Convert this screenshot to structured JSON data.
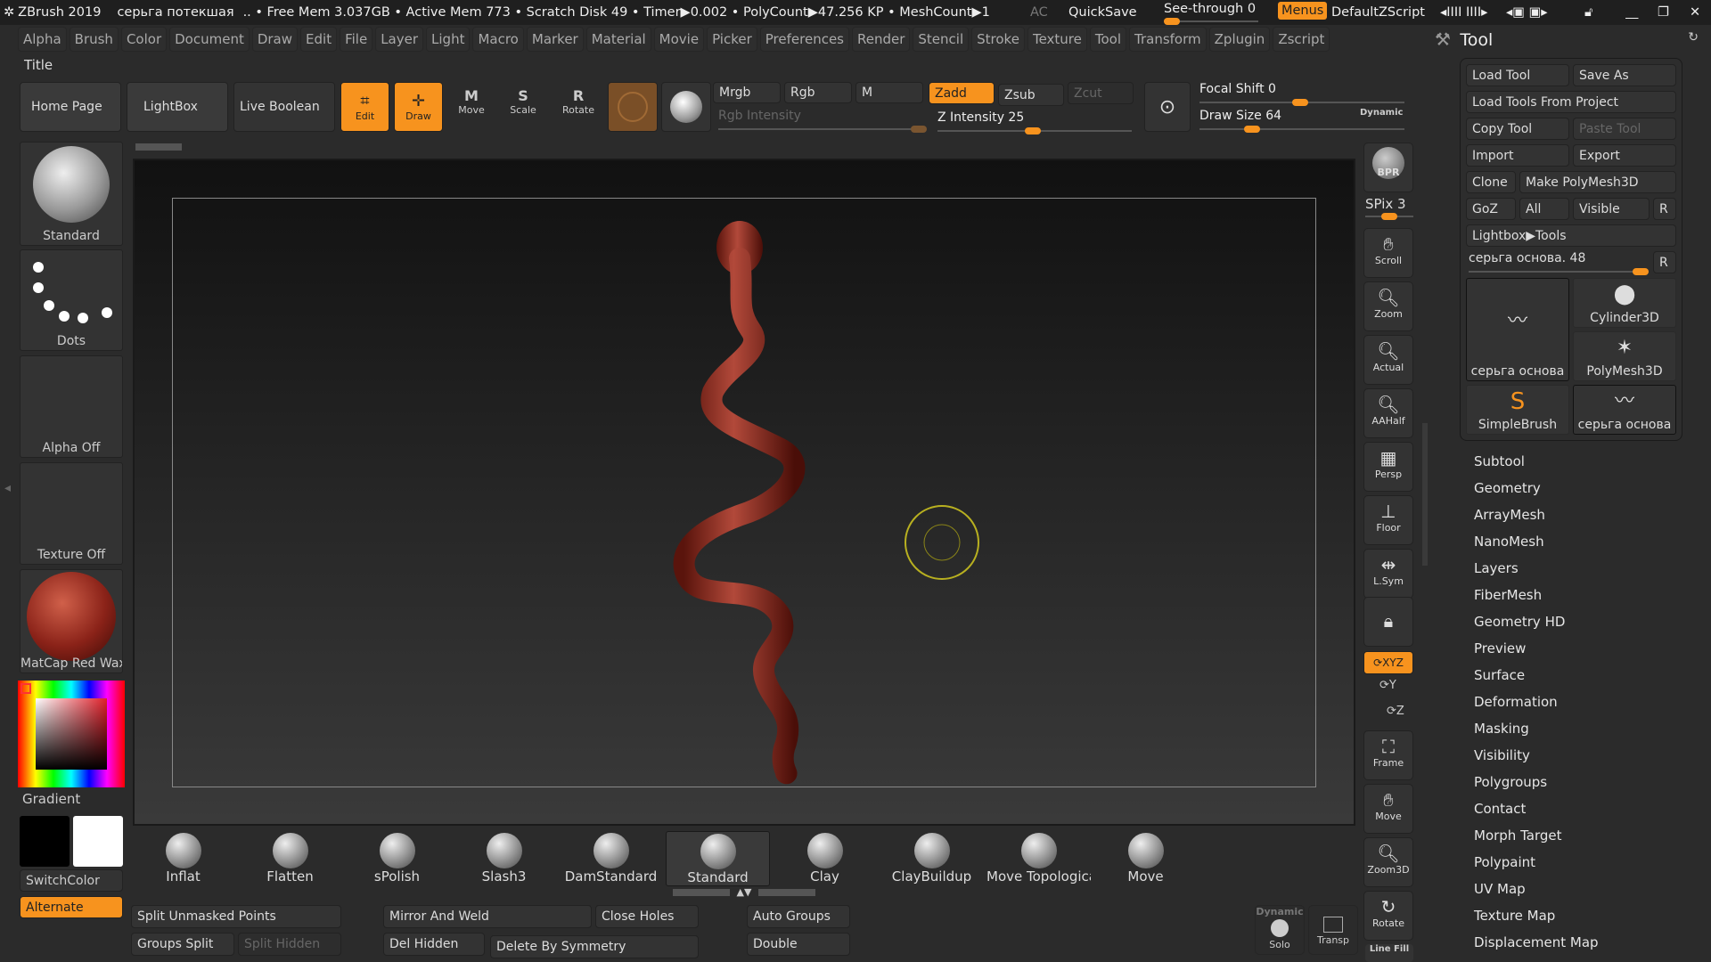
{
  "titlebar": {
    "app": "ZBrush 2019",
    "doc": "серьга потекшая",
    "stats": ".. • Free Mem 3.037GB • Active Mem 773 • Scratch Disk 49 •  Timer▶0.002 • PolyCount▶47.256 KP  • MeshCount▶1",
    "ac": "AC",
    "quicksave": "QuickSave",
    "seethrough": "See-through  0",
    "seethrough_value": 0,
    "menus": "Menus",
    "zscript": "DefaultZScript"
  },
  "menubar": [
    "Alpha",
    "Brush",
    "Color",
    "Document",
    "Draw",
    "Edit",
    "File",
    "Layer",
    "Light",
    "Macro",
    "Marker",
    "Material",
    "Movie",
    "Picker",
    "Preferences",
    "Render",
    "Stencil",
    "Stroke",
    "Texture",
    "Tool",
    "Transform",
    "Zplugin",
    "Zscript"
  ],
  "title_label": "Title",
  "toolbar": {
    "home": "Home Page",
    "lightbox": "LightBox",
    "liveboolean": "Live Boolean",
    "edit": "Edit",
    "draw": "Draw",
    "move": "Move",
    "scale": "Scale",
    "rotate": "Rotate",
    "mrgb": "Mrgb",
    "rgb": "Rgb",
    "m": "M",
    "zadd": "Zadd",
    "zsub": "Zsub",
    "zcut": "Zcut",
    "rgb_intensity": "Rgb Intensity",
    "z_intensity": "Z Intensity 25",
    "z_intensity_value": 25,
    "focal_shift": "Focal Shift 0",
    "focal_value": 0,
    "draw_size": "Draw Size 64",
    "draw_size_value": 64,
    "dynamic": "Dynamic"
  },
  "left": {
    "brush": "Standard",
    "stroke": "Dots",
    "alpha": "Alpha Off",
    "texture": "Texture Off",
    "material": "MatCap Red Wax",
    "gradient": "Gradient",
    "switchcolor": "SwitchColor",
    "alternate": "Alternate",
    "accent": "#f7931e"
  },
  "rightstrip": {
    "bpr": "BPR",
    "spix": "SPix 3",
    "items": [
      "Scroll",
      "Zoom",
      "Actual",
      "AAHalf",
      "Persp",
      "Floor",
      "L.Sym"
    ],
    "dynamic": "Dynamic",
    "xyz": "XYZ",
    "frame": "Frame",
    "move": "Move",
    "zoom3d": "Zoom3D",
    "rotate": "Rotate",
    "linefill": "Line Fill",
    "solo": "Solo",
    "transp": "Transp"
  },
  "tool": {
    "title": "Tool",
    "load": "Load Tool",
    "saveas": "Save As",
    "loadproject": "Load Tools From Project",
    "copy": "Copy Tool",
    "paste": "Paste Tool",
    "import": "Import",
    "export": "Export",
    "clone": "Clone",
    "makepoly": "Make PolyMesh3D",
    "goz": "GoZ",
    "all": "All",
    "visible": "Visible",
    "r": "R",
    "lightbox": "Lightbox▶Tools",
    "slider": "серьга основа. 48",
    "slider_value": 48,
    "thumbs": [
      "серьга основа",
      "Cylinder3D",
      "PolyMesh3D",
      "SimpleBrush",
      "серьга основа"
    ],
    "menu": [
      "Subtool",
      "Geometry",
      "ArrayMesh",
      "NanoMesh",
      "Layers",
      "FiberMesh",
      "Geometry HD",
      "Preview",
      "Surface",
      "Deformation",
      "Masking",
      "Visibility",
      "Polygroups",
      "Contact",
      "Morph Target",
      "Polypaint",
      "UV Map",
      "Texture Map",
      "Displacement Map"
    ]
  },
  "brushes": [
    "Inflat",
    "Flatten",
    "sPolish",
    "Slash3",
    "DamStandard",
    "Standard",
    "Clay",
    "ClayBuildup",
    "Move Topologica",
    "Move"
  ],
  "bottom": {
    "split_unmasked": "Split Unmasked Points",
    "groups_split": "Groups Split",
    "split_hidden": "Split Hidden",
    "mirror_weld": "Mirror And Weld",
    "del_hidden": "Del Hidden",
    "close_holes": "Close Holes",
    "delete_sym": "Delete By Symmetry",
    "auto_groups": "Auto Groups",
    "double": "Double"
  }
}
